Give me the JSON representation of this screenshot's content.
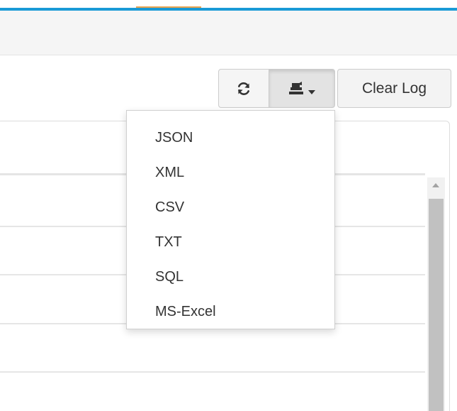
{
  "toolbar": {
    "refresh_icon": "refresh-icon",
    "export_icon": "export-icon",
    "caret_icon": "caret-down-icon",
    "clear_label": "Clear Log"
  },
  "export_menu": {
    "items": [
      "JSON",
      "XML",
      "CSV",
      "TXT",
      "SQL",
      "MS-Excel"
    ]
  },
  "colors": {
    "accent": "#1a9ad6",
    "accent_secondary": "#e8a34f"
  }
}
